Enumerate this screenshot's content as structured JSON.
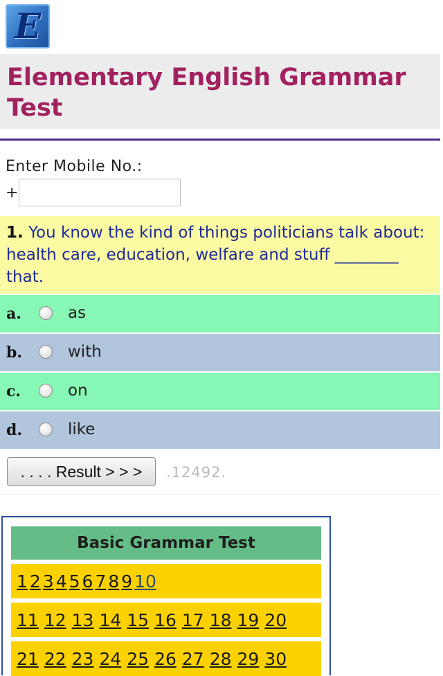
{
  "logo": {
    "letter": "E"
  },
  "header": {
    "title": "Elementary English Grammar Test"
  },
  "mobile": {
    "label": "Enter Mobile No.:",
    "prefix": "+",
    "value": ""
  },
  "question": {
    "number": "1.",
    "text": "You know the kind of things politicians talk about: health care, education, welfare and stuff ________ that."
  },
  "options": [
    {
      "letter": "a.",
      "text": "as"
    },
    {
      "letter": "b.",
      "text": "with"
    },
    {
      "letter": "c.",
      "text": "on"
    },
    {
      "letter": "d.",
      "text": "like"
    }
  ],
  "result": {
    "button_label": ". . . . Result > > >",
    "code": ".12492."
  },
  "test_panel": {
    "heading": "Basic Grammar Test",
    "rows": [
      [
        "1",
        "2",
        "3",
        "4",
        "5",
        "6",
        "7",
        "8",
        "9",
        "10"
      ],
      [
        "11",
        "12",
        "13",
        "14",
        "15",
        "16",
        "17",
        "18",
        "19",
        "20"
      ],
      [
        "21",
        "22",
        "23",
        "24",
        "25",
        "26",
        "27",
        "28",
        "29",
        "30"
      ]
    ]
  },
  "colors": {
    "title": "#a2225f",
    "question_bg": "#fafaa2",
    "option_green": "#86f7b4",
    "option_blue": "#b1c5dc",
    "panel_header": "#64bd86",
    "panel_rows": "#fbd200"
  }
}
